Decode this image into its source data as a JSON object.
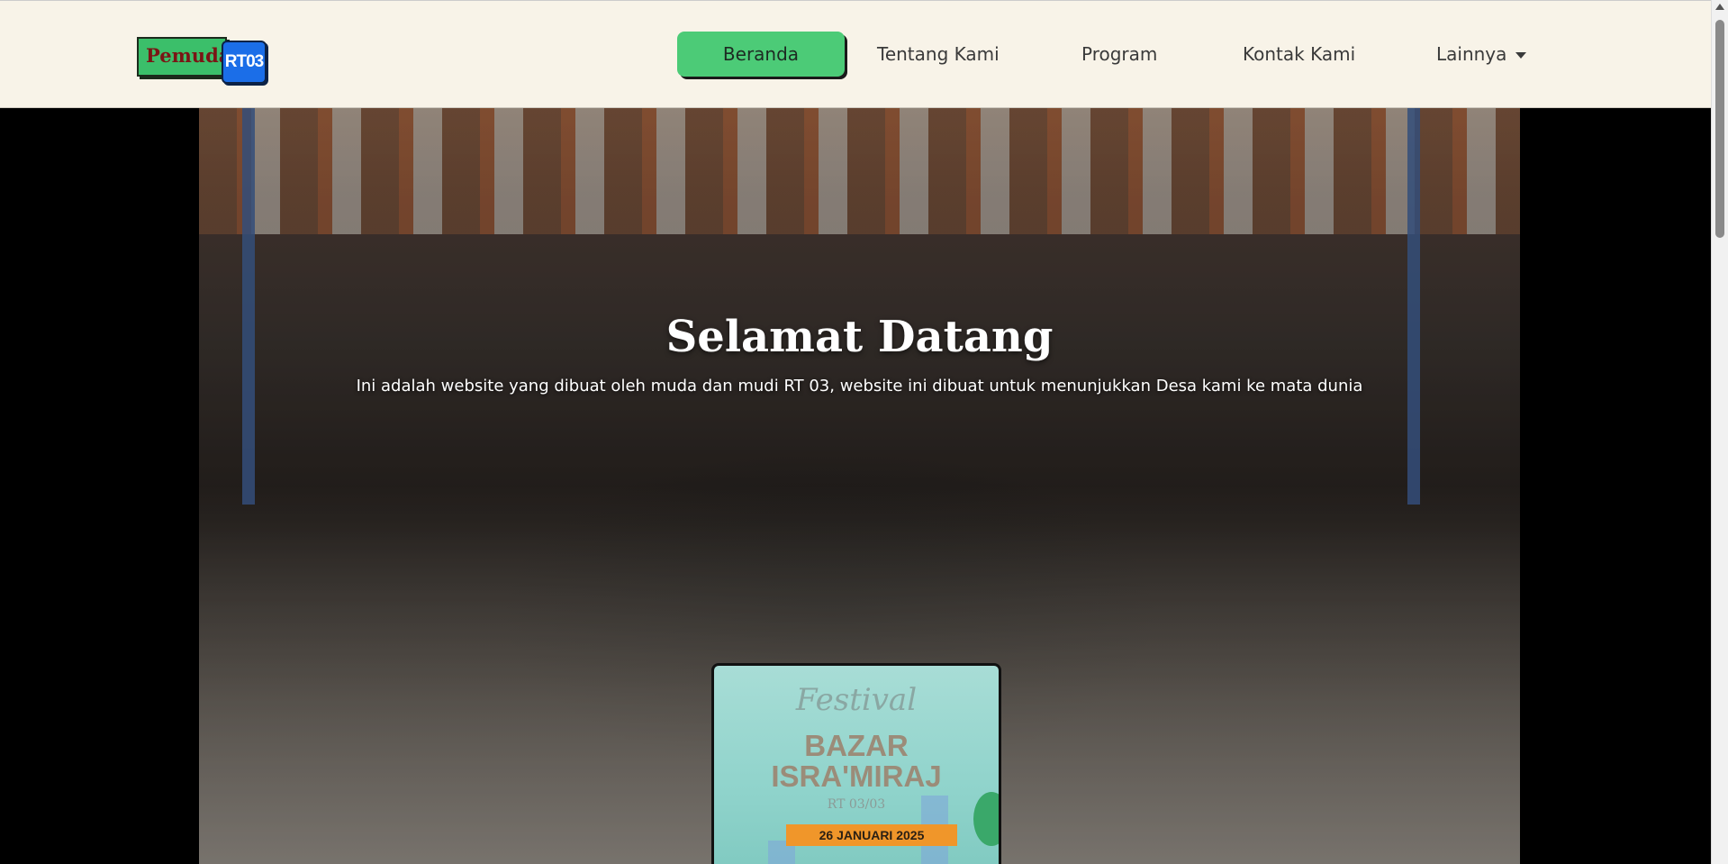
{
  "brand": {
    "part1": "Pemuda",
    "part2": "RT03"
  },
  "nav": {
    "items": [
      {
        "label": "Beranda",
        "active": true
      },
      {
        "label": "Tentang Kami",
        "active": false
      },
      {
        "label": "Program",
        "active": false
      },
      {
        "label": "Kontak Kami",
        "active": false
      },
      {
        "label": "Lainnya",
        "active": false,
        "dropdown": true
      }
    ]
  },
  "hero": {
    "title": "Selamat Datang",
    "subtitle": "Ini adalah website yang dibuat oleh muda dan mudi RT 03, website ini dibuat untuk menunjukkan Desa kami ke mata dunia"
  },
  "poster": {
    "script": "Festival",
    "title_line1": "BAZAR",
    "title_line2": "ISRA'MIRAJ",
    "rt": "RT 03/03",
    "date": "26 JANUARI 2025"
  },
  "colors": {
    "navbar_bg": "#f8f3e8",
    "active_nav": "#4ccb77",
    "logo_green": "#3bbf6a",
    "logo_blue": "#1b6ee8",
    "poster_accent": "#f0962a"
  }
}
